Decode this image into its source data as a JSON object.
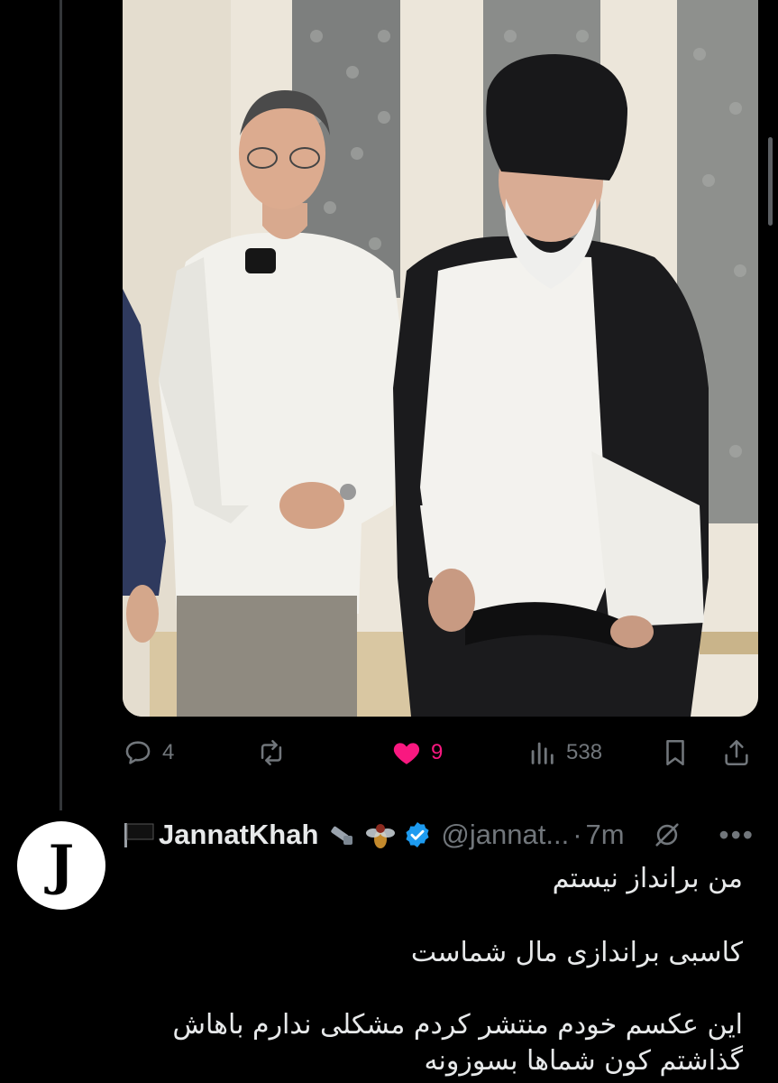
{
  "actions": {
    "replies": "4",
    "likes": "9",
    "views": "538"
  },
  "reply": {
    "avatar_letter": "J",
    "name": "JannatKhah",
    "handle": "@jannat...",
    "separator": "·",
    "time": "7m",
    "text": [
      "من برانداز نیستم",
      "کاسبی براندازی مال شماست",
      "این عکسم خودم منتشر کردم مشکلی ندارم باهاش گذاشتم کون شماها بسوزونه"
    ]
  },
  "colors": {
    "background": "#000000",
    "muted": "#71767b",
    "like": "#f91880",
    "verified": "#1d9bf0"
  }
}
